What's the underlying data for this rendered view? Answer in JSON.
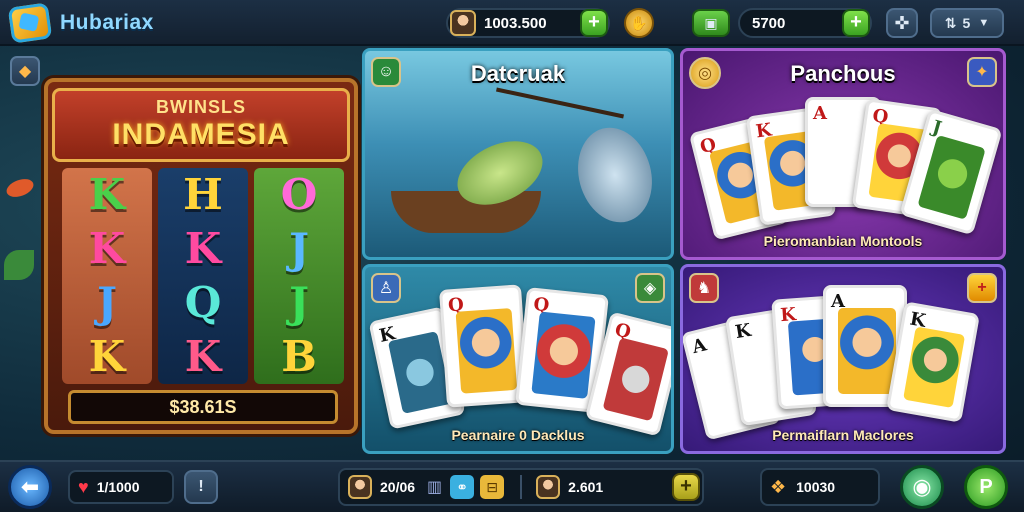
{
  "header": {
    "app_title": "Hubariax",
    "player_coins": "1003.500",
    "wallet_amount": "5700",
    "level_value": "5"
  },
  "panels": {
    "slot": {
      "subtitle": "BWINSLS",
      "title": "INDAMESIA",
      "win_amount": "$38.61S",
      "reels": [
        [
          "K",
          "K",
          "J",
          "K"
        ],
        [
          "H",
          "K",
          "Q",
          "K"
        ],
        [
          "O",
          "J",
          "J",
          "B"
        ]
      ]
    },
    "fishing": {
      "title": "Datcruak"
    },
    "cards_top": {
      "title": "Panchous",
      "caption": "Pieromanbian Montools"
    },
    "cards_bottom_left": {
      "caption": "Pearnaire 0 Dacklus"
    },
    "cards_bottom_right": {
      "caption": "Permaiflarn Maclores"
    }
  },
  "footer": {
    "hearts_value": "1/1000",
    "stat_a_value": "20/06",
    "stat_b_value": "2.601",
    "gems_value": "10030"
  },
  "colors": {
    "green_button": "#3ba322",
    "accent_blue": "#3aa0c0",
    "gold": "#e9b04a",
    "purple_panel": "#8a3ab0"
  }
}
